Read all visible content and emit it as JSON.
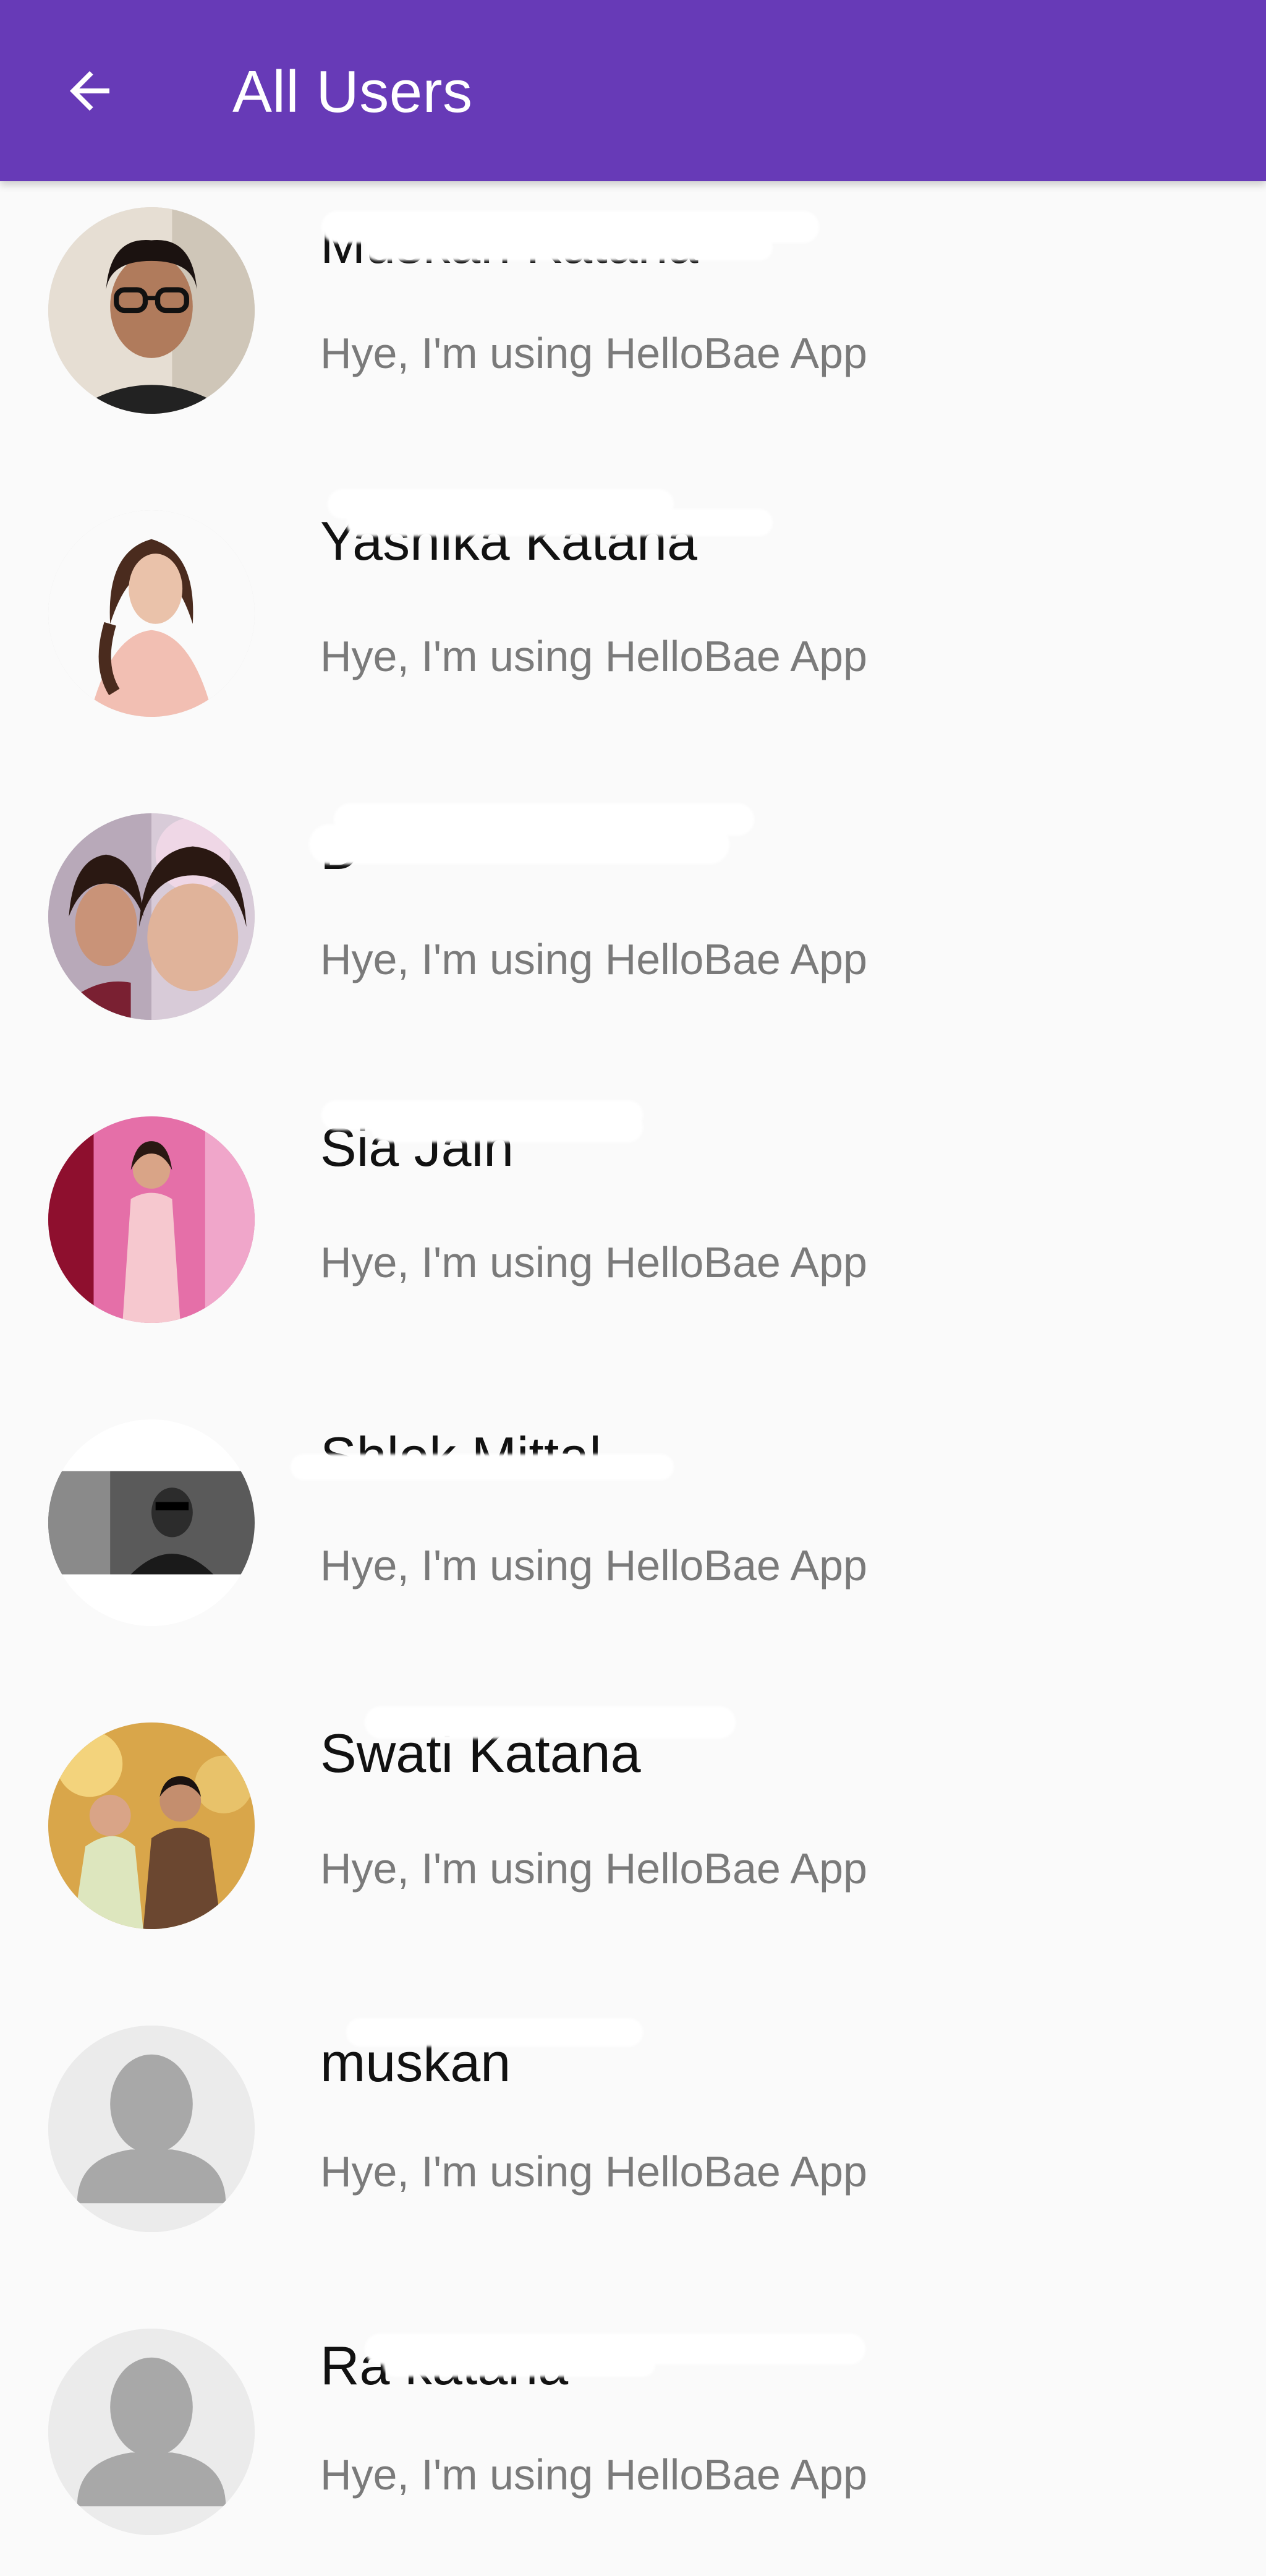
{
  "app_bar": {
    "title": "All Users",
    "back_icon": "arrow-left-icon",
    "background": "#673AB7"
  },
  "users": [
    {
      "name": "Muskan Katana",
      "status": "Hye, I'm using HelloBae App",
      "avatar": "photo"
    },
    {
      "name": "Yashika Katana",
      "status": "Hye, I'm using HelloBae App",
      "avatar": "photo"
    },
    {
      "name": "D",
      "status": "Hye, I'm using HelloBae App",
      "avatar": "photo"
    },
    {
      "name": "Sia Jain",
      "status": "Hye, I'm using HelloBae App",
      "avatar": "photo"
    },
    {
      "name": "Shlok Mittal",
      "status": "Hye, I'm using HelloBae App",
      "avatar": "photo"
    },
    {
      "name": "Swati Katana",
      "status": "Hye, I'm using HelloBae App",
      "avatar": "photo"
    },
    {
      "name": "muskan",
      "status": "Hye, I'm using HelloBae App",
      "avatar": "default-person-icon"
    },
    {
      "name": "Ra katana",
      "status": "Hye, I'm using HelloBae App",
      "avatar": "default-person-icon"
    }
  ]
}
